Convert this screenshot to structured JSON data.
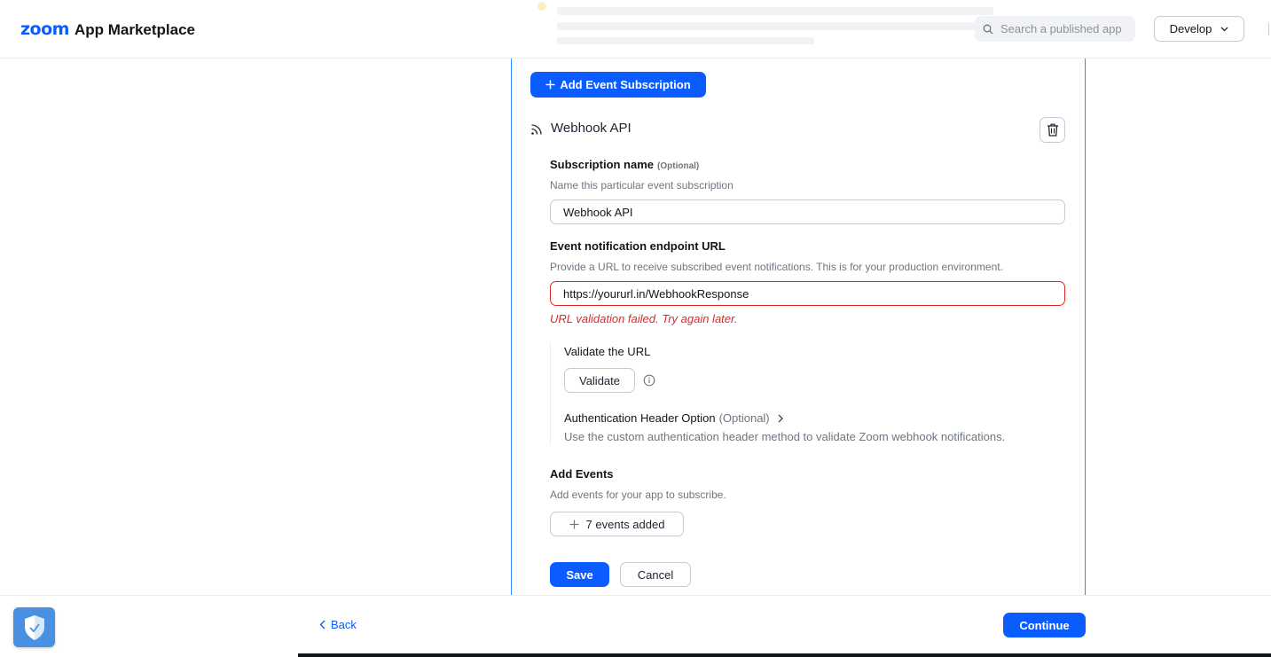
{
  "header": {
    "logo_brand": "zoom",
    "logo_text": "App Marketplace",
    "search_placeholder": "Search a published app",
    "develop_label": "Develop"
  },
  "card": {
    "add_subscription_label": "Add Event Subscription",
    "subscription_type": "Webhook API",
    "subscription_name": {
      "label": "Subscription name",
      "optional": "(Optional)",
      "help": "Name this particular event subscription",
      "value": "Webhook API"
    },
    "endpoint": {
      "label": "Event notification endpoint URL",
      "help": "Provide a URL to receive subscribed event notifications. This is for your production environment.",
      "value": "https://yoururl.in/WebhookResponse",
      "error": "URL validation failed. Try again later."
    },
    "validate": {
      "title": "Validate the URL",
      "button": "Validate",
      "auth_label": "Authentication Header Option",
      "auth_optional": "(Optional)",
      "auth_help": "Use the custom authentication header method to validate Zoom webhook notifications."
    },
    "events": {
      "label": "Add Events",
      "help": "Add events for your app to subscribe.",
      "button": "7 events added"
    },
    "save_label": "Save",
    "cancel_label": "Cancel"
  },
  "footer": {
    "back_label": "Back",
    "continue_label": "Continue"
  },
  "colors": {
    "primary": "#0b5cff",
    "error": "#de2828",
    "card_border": "#2d8cff"
  }
}
